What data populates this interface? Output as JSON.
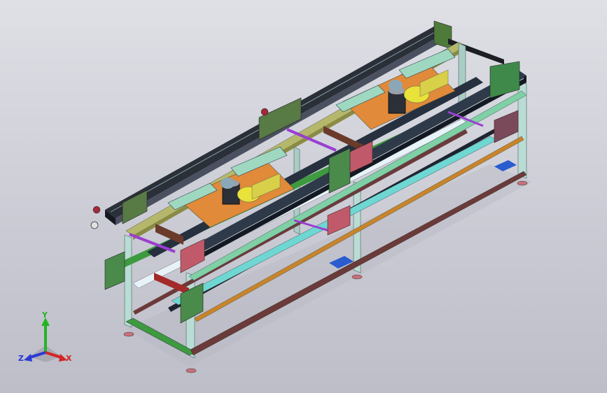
{
  "colors": {
    "background_top": "#dfe0e6",
    "background_bottom": "#bdbec8",
    "frame_light": "#b9dcd4",
    "frame_green": "#3e9a3e",
    "frame_brown": "#6b3a3a",
    "frame_orange": "#c8842c",
    "rail_dark": "#22262e",
    "plate_orange": "#e08a3a",
    "plate_yellow": "#e8e23a",
    "purple_rod": "#9a3ed0",
    "pink_plate": "#c05a6a",
    "blue_pad": "#2a5cd0",
    "axis_x": "#d42424",
    "axis_y": "#24b424",
    "axis_z": "#2a3ad4"
  },
  "triad": {
    "x_label": "X",
    "y_label": "Y",
    "z_label": "Z"
  }
}
